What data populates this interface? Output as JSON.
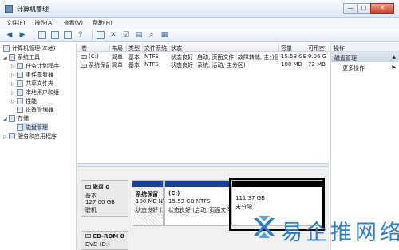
{
  "window": {
    "title": "计算机管理",
    "buttons": {
      "min": "—",
      "max": "□",
      "close": "✕"
    }
  },
  "menu": [
    "文件(F)",
    "操作(A)",
    "查看(V)",
    "帮助(H)"
  ],
  "toolbar_icons": [
    "back-icon",
    "forward-icon",
    "up-icon",
    "show-hide-tree-icon",
    "properties-icon",
    "help-icon",
    "console-icon",
    "delete-icon",
    "properties2-icon",
    "open-icon",
    "search-icon",
    "refresh-icon"
  ],
  "tree": {
    "root": "计算机管理(本地)",
    "system_tools": "系统工具",
    "task_scheduler": "任务计划程序",
    "event_viewer": "事件查看器",
    "shared_folders": "共享文件夹",
    "local_users": "本地用户和组",
    "performance": "性能",
    "device_manager": "设备管理器",
    "storage": "存储",
    "disk_management": "磁盘管理",
    "services": "服务和应用程序"
  },
  "volume_table": {
    "headers": [
      "卷",
      "布局",
      "类型",
      "文件系统",
      "状态",
      "容量",
      "可用空"
    ],
    "rows": [
      [
        "(C:)",
        "简单",
        "基本",
        "NTFS",
        "状态良好 (启动, 页面文件, 故障转储, 主分区)",
        "15.53 GB",
        "9.06 G"
      ],
      [
        "系统保留",
        "简单",
        "基本",
        "NTFS",
        "状态良好 (系统, 活动, 主分区)",
        "100 MB",
        "72 MB"
      ]
    ]
  },
  "actions": {
    "header": "操作",
    "section": "磁盘管理",
    "more": "更多操作",
    "arrow_up": "▲",
    "arrow_right": "▶"
  },
  "disk0": {
    "name": "磁盘 0",
    "type": "基本",
    "size": "127.00 GB",
    "status": "联机"
  },
  "partitions": [
    {
      "name": "系统保留",
      "detail": "100 MB NTFS",
      "status": "状态良好 (系"
    },
    {
      "name": "(C:)",
      "detail": "15.53 GB NTFS",
      "status": "状态良好 (启动, 页面文件"
    },
    {
      "size": "111.37 GB",
      "status": "未分配"
    }
  ],
  "cdrom": {
    "name": "CD-ROM 0",
    "drive": "DVD (D:)"
  },
  "watermark": "易企推网络",
  "colors": {
    "primary_partition_bar": "#1a3f9e",
    "unallocated_bar": "#000000",
    "selection": "#cfe0f5",
    "watermark": "#2f7ec7"
  }
}
